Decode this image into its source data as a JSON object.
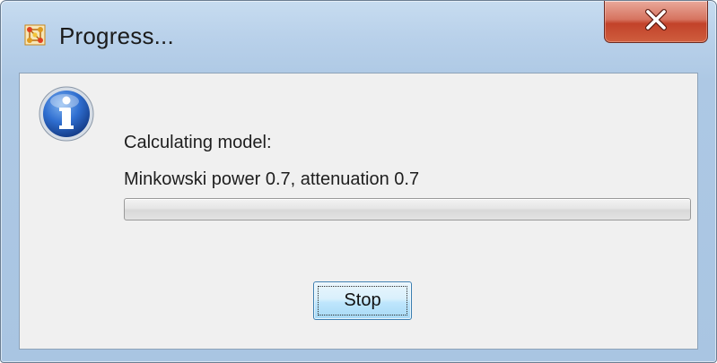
{
  "window": {
    "title": "Progress...",
    "app_icon": "network-grid-icon",
    "close_icon": "close-x-icon"
  },
  "dialog": {
    "icon": "info-icon",
    "message_line1": "Calculating model:",
    "message_line2": "Minkowski power 0.7, attenuation 0.7",
    "progress_fraction": 0,
    "stop_label": "Stop"
  },
  "colors": {
    "close_button": "#c7432c",
    "info_icon": "#2a5fb8",
    "app_icon": "#d98a1a"
  }
}
